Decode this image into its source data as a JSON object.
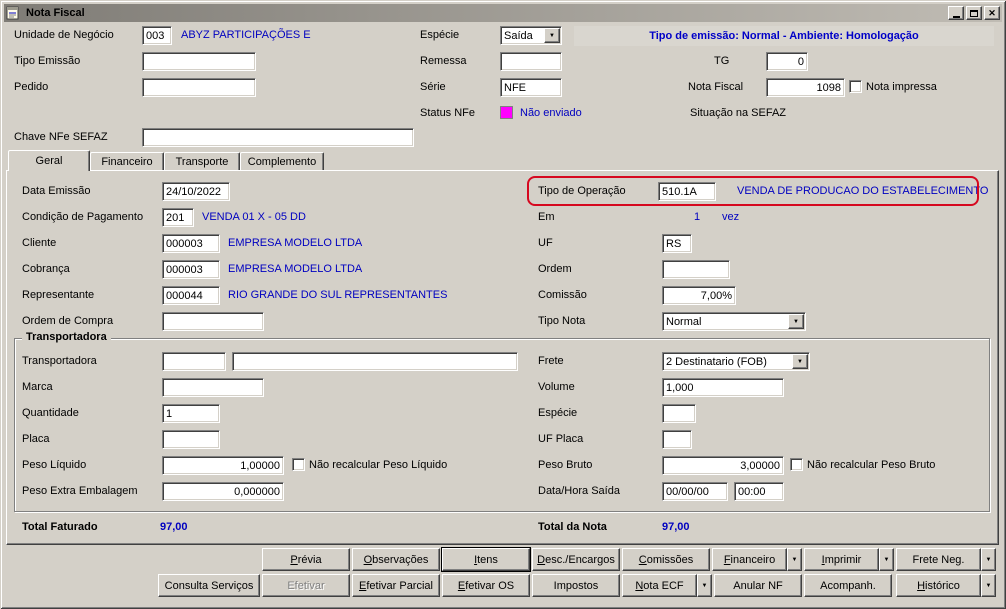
{
  "window": {
    "title": "Nota Fiscal"
  },
  "icons": {
    "close": "✕",
    "dropdown": "▼"
  },
  "colors": {
    "background": "#d4d0c8",
    "accent_blue": "#0000c0",
    "banner_blue": "#0000c8",
    "status_magenta": "#ff00ff",
    "highlight_red": "#d6081f"
  },
  "header": {
    "unidade": {
      "label": "Unidade de Negócio",
      "value": "003",
      "desc": "ABYZ PARTICIPAÇÕES E"
    },
    "especie": {
      "label": "Espécie",
      "value": "Saída"
    },
    "banner": "Tipo de emissão: Normal - Ambiente: Homologação",
    "tipo_emissao": {
      "label": "Tipo Emissão",
      "value": ""
    },
    "remessa": {
      "label": "Remessa",
      "value": ""
    },
    "tg": {
      "label": "TG",
      "value": "0"
    },
    "pedido": {
      "label": "Pedido",
      "value": ""
    },
    "serie": {
      "label": "Série",
      "value": "NFE"
    },
    "nota_fiscal": {
      "label": "Nota Fiscal",
      "value": "1098"
    },
    "nota_impressa_label": "Nota impressa",
    "status_nfe": {
      "label": "Status NFe",
      "value": "Não enviado"
    },
    "sefaz_label": "Situação na SEFAZ",
    "chave": {
      "label": "Chave NFe SEFAZ",
      "value": ""
    }
  },
  "tabs": {
    "geral": "Geral",
    "financeiro": "Financeiro",
    "transporte": "Transporte",
    "complemento": "Complemento"
  },
  "geral": {
    "data_emissao": {
      "label": "Data Emissão",
      "value": "24/10/2022"
    },
    "tipo_operacao": {
      "label": "Tipo de Operação",
      "value": "510.1A",
      "desc": "VENDA DE PRODUCAO DO ESTABELECIMENTO"
    },
    "condicao_pagamento": {
      "label": "Condição de Pagamento",
      "value": "201",
      "desc": "VENDA 01 X - 05 DD"
    },
    "em": {
      "label": "Em",
      "value": "1",
      "suffix": "vez"
    },
    "cliente": {
      "label": "Cliente",
      "value": "000003",
      "desc": "EMPRESA MODELO LTDA"
    },
    "uf": {
      "label": "UF",
      "value": "RS"
    },
    "cobranca": {
      "label": "Cobrança",
      "value": "000003",
      "desc": "EMPRESA MODELO LTDA"
    },
    "ordem": {
      "label": "Ordem",
      "value": ""
    },
    "representante": {
      "label": "Representante",
      "value": "000044",
      "desc": "RIO GRANDE DO SUL REPRESENTANTES"
    },
    "comissao": {
      "label": "Comissão",
      "value": "7,00%"
    },
    "ordem_compra": {
      "label": "Ordem de Compra",
      "value": ""
    },
    "tipo_nota": {
      "label": "Tipo Nota",
      "value": "Normal"
    }
  },
  "transportadora": {
    "title": "Transportadora",
    "transportadora": {
      "label": "Transportadora",
      "code": "",
      "desc": ""
    },
    "frete": {
      "label": "Frete",
      "value": "2 Destinatario (FOB)"
    },
    "marca": {
      "label": "Marca",
      "value": ""
    },
    "volume": {
      "label": "Volume",
      "value": "1,000"
    },
    "quantidade": {
      "label": "Quantidade",
      "value": "1"
    },
    "especie": {
      "label": "Espécie",
      "value": ""
    },
    "placa": {
      "label": "Placa",
      "value": ""
    },
    "uf_placa": {
      "label": "UF Placa",
      "value": ""
    },
    "peso_liquido": {
      "label": "Peso Líquido",
      "value": "1,00000",
      "check_label": "Não recalcular Peso Líquido"
    },
    "peso_bruto": {
      "label": "Peso Bruto",
      "value": "3,00000",
      "check_label": "Não recalcular Peso Bruto"
    },
    "peso_extra": {
      "label": "Peso Extra Embalagem",
      "value": "0,000000"
    },
    "data_saida": {
      "label": "Data/Hora Saída",
      "date": "00/00/00",
      "time": "00:00"
    }
  },
  "totals": {
    "faturado_label": "Total Faturado",
    "faturado_value": "97,00",
    "nota_label": "Total da Nota",
    "nota_value": "97,00"
  },
  "buttons": {
    "row1": [
      "Prévia",
      "Observações",
      "Itens",
      "Desc./Encargos",
      "Comissões",
      "Financeiro",
      "Imprimir",
      "Frete Neg."
    ],
    "row2": [
      "Consulta Serviços",
      "Efetivar",
      "Efetivar Parcial",
      "Efetivar OS",
      "Impostos",
      "Nota ECF",
      "Anular NF",
      "Acompanh.",
      "Histórico"
    ]
  }
}
